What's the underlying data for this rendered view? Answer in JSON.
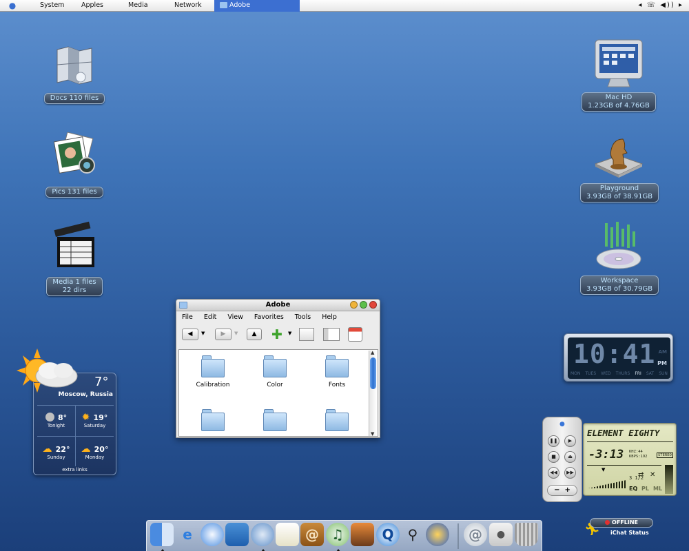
{
  "menubar": {
    "items": [
      "System",
      "Apples",
      "Media",
      "Network"
    ],
    "active": "Adobe",
    "tray": "◂ ☏ ◀)) ▸"
  },
  "desktop": {
    "left": [
      {
        "icon": "map-icon",
        "label": "Docs 110 files"
      },
      {
        "icon": "photos-icon",
        "label": "Pics 131 files"
      },
      {
        "icon": "clapperboard-icon",
        "label1": "Media 1 files",
        "label2": "22 dirs"
      }
    ],
    "right": [
      {
        "icon": "display-icon",
        "label1": "Mac HD",
        "label2": "1.23GB of 4.76GB"
      },
      {
        "icon": "chess-knight-icon",
        "label1": "Playground",
        "label2": "3.93GB of 38.91GB"
      },
      {
        "icon": "matrix-disc-icon",
        "label1": "Workspace",
        "label2": "3.93GB of 30.79GB"
      }
    ]
  },
  "window": {
    "title": "Adobe",
    "menus": [
      "File",
      "Edit",
      "View",
      "Favorites",
      "Tools",
      "Help"
    ],
    "folders": [
      "Calibration",
      "Color",
      "Fonts",
      "",
      "",
      ""
    ]
  },
  "weather": {
    "temp": "7°",
    "city": "Moscow, Russia",
    "forecast": [
      {
        "temp": "8°",
        "label": "Tonight",
        "icon": "moon-icon"
      },
      {
        "temp": "19°",
        "label": "Saturday",
        "icon": "sun-icon"
      },
      {
        "temp": "22°",
        "label": "Sunday",
        "icon": "partly-cloudy-icon"
      },
      {
        "temp": "20°",
        "label": "Monday",
        "icon": "partly-cloudy-icon"
      }
    ],
    "footer": "extra links"
  },
  "clock": {
    "time": "10:41",
    "am": "AM",
    "pm": "PM",
    "days": [
      "MON",
      "TUES",
      "WED",
      "THURS",
      "FRI",
      "SAT",
      "SUN"
    ],
    "active_day": "FRI"
  },
  "player": {
    "name": "ELEMENT EIGHTY",
    "time": "-3:13",
    "khz": "KHZ:44",
    "kbps": "KBPS:192",
    "stereo": "STEREO",
    "eq": "EQ",
    "pl": "PL",
    "ml": "ML",
    "fraction": "3 1/2"
  },
  "ichat": {
    "status": "OFFLINE",
    "label": "iChat Status"
  },
  "dock": {
    "items": [
      "finder-icon",
      "internet-explorer-icon",
      "safari-icon",
      "image-capture-icon",
      "ichat-icon",
      "textedit-icon",
      "address-book-icon",
      "itunes-icon",
      "iphoto-icon",
      "quicktime-icon",
      "sherlock-icon",
      "firefox-icon",
      "mail-icon",
      "system-prefs-icon",
      "trash-icon"
    ]
  },
  "colors": {
    "accent": "#3c6fd1",
    "label_text": "#bfe4ff"
  }
}
